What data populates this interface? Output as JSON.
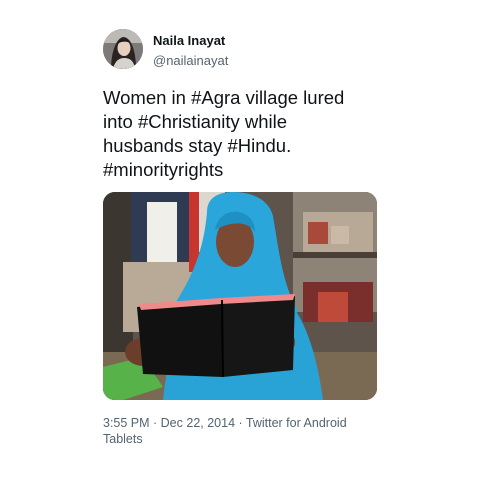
{
  "author": {
    "name": "Naila Inayat",
    "handle": "@nailainayat"
  },
  "tweet": {
    "lines": [
      "Women in #Agra village lured",
      "into #Christianity while",
      "husbands stay #Hindu.",
      "#minorityrights"
    ]
  },
  "photo": {
    "subject": "woman-reading-book"
  },
  "meta": {
    "line1": "3:55 PM · Dec 22, 2014 · Twitter for Android",
    "line2": "Tablets"
  },
  "colors": {
    "text_primary": "#0f1419",
    "text_secondary": "#536471",
    "background": "#ffffff"
  }
}
